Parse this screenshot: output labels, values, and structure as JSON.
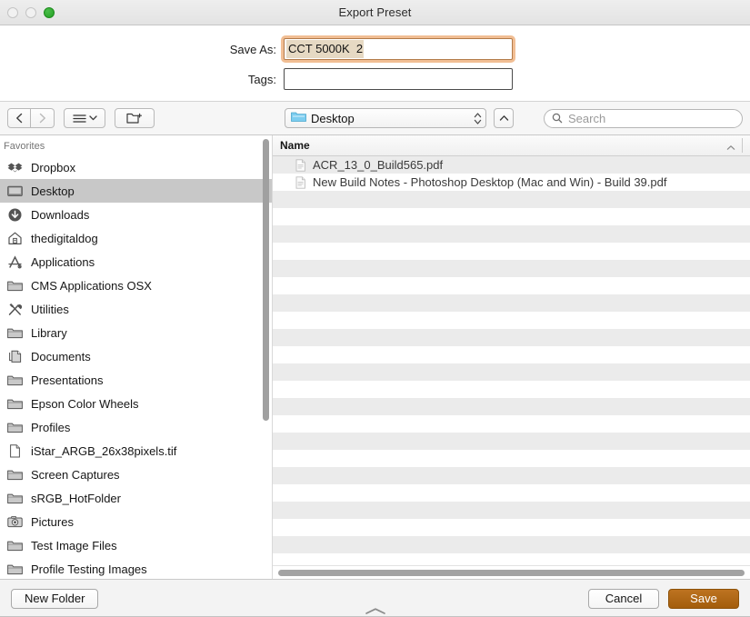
{
  "window": {
    "title": "Export Preset",
    "traffic_lights": [
      "close-disabled",
      "minimize-disabled",
      "zoom-green"
    ]
  },
  "fields": {
    "save_as_label": "Save As:",
    "save_as_value": "CCT 5000K  2",
    "save_as_selected": true,
    "tags_label": "Tags:",
    "tags_value": "",
    "tags_placeholder": ""
  },
  "toolbar": {
    "back_icon": "chevron-left-icon",
    "forward_icon": "chevron-right-icon",
    "forward_disabled": true,
    "view_icon": "list-view-icon",
    "view_chevron": "chevron-down-icon",
    "new_folder_icon": "new-folder-icon",
    "path_popup": {
      "icon": "blue-folder-icon",
      "label": "Desktop",
      "stepper_icon": "up-down-chevrons-icon"
    },
    "enclosing_folder_icon": "chevron-up-icon",
    "search": {
      "icon": "search-icon",
      "placeholder": "Search",
      "value": ""
    }
  },
  "sidebar": {
    "header": "Favorites",
    "selected_index": 1,
    "items": [
      {
        "label": "Dropbox",
        "icon": "dropbox-icon"
      },
      {
        "label": "Desktop",
        "icon": "desktop-monitor-icon"
      },
      {
        "label": "Downloads",
        "icon": "downloads-arrow-icon"
      },
      {
        "label": "thedigitaldog",
        "icon": "home-house-icon"
      },
      {
        "label": "Applications",
        "icon": "applications-a-icon"
      },
      {
        "label": "CMS Applications OSX",
        "icon": "folder-icon"
      },
      {
        "label": "Utilities",
        "icon": "utilities-tools-icon"
      },
      {
        "label": "Library",
        "icon": "folder-icon"
      },
      {
        "label": "Documents",
        "icon": "documents-icon"
      },
      {
        "label": "Presentations",
        "icon": "folder-icon"
      },
      {
        "label": "Epson Color Wheels",
        "icon": "folder-icon"
      },
      {
        "label": "Profiles",
        "icon": "folder-icon"
      },
      {
        "label": "iStar_ARGB_26x38pixels.tif",
        "icon": "file-document-icon"
      },
      {
        "label": "Screen Captures",
        "icon": "folder-icon"
      },
      {
        "label": "sRGB_HotFolder",
        "icon": "folder-icon"
      },
      {
        "label": "Pictures",
        "icon": "pictures-camera-icon"
      },
      {
        "label": "Test Image Files",
        "icon": "folder-icon"
      },
      {
        "label": "Profile Testing Images",
        "icon": "folder-icon"
      }
    ]
  },
  "filelist": {
    "column_header": "Name",
    "sort_indicator": "chevron-up-icon",
    "files": [
      {
        "name": "ACR_13_0_Build565.pdf",
        "icon": "pdf-file-icon"
      },
      {
        "name": "New Build Notes - Photoshop Desktop (Mac and Win) - Build 39.pdf",
        "icon": "pdf-file-icon"
      }
    ],
    "empty_row_count": 22,
    "horizontal_scrollbar": true
  },
  "footer": {
    "new_folder_label": "New Folder",
    "cancel_label": "Cancel",
    "save_label": "Save",
    "resize_handle_icon": "chevron-up-icon"
  },
  "colors": {
    "accent": "#a35d0c",
    "selection_highlight": "#e6d9c3",
    "focus_ring": "#f0bb8e",
    "sidebar_selected": "#c8c8c8",
    "row_alt": "#ebebeb"
  }
}
